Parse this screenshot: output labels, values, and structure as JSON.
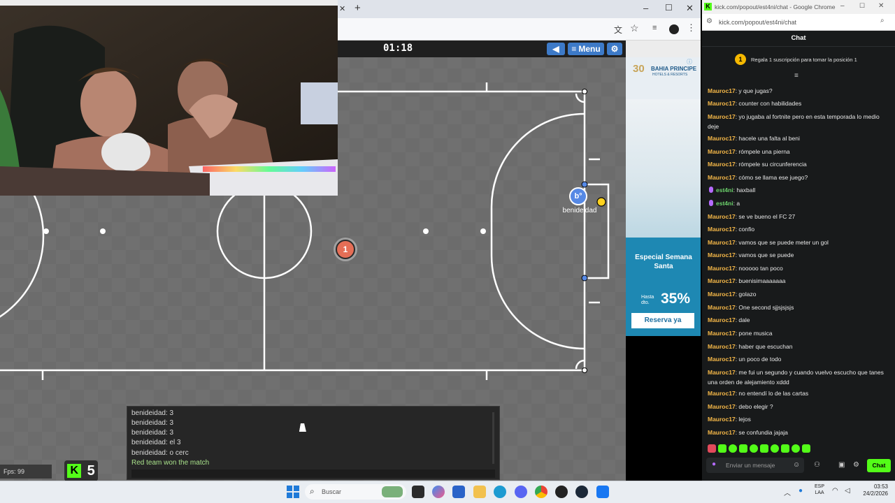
{
  "browser_left": {
    "new_tab_label": "+",
    "window_controls": [
      "–",
      "☐",
      "✕"
    ]
  },
  "game": {
    "timer": "01:18",
    "menu_label": "Menu",
    "player_red_number": "1",
    "player_blue_label": "b°",
    "player_blue_name": "benideidad",
    "fps": "Fps: 99",
    "kick_score": "5",
    "chat": [
      "benideidad: 3",
      "benideidad: 3",
      "benideidad: 3",
      "benideidad: el 3",
      "benideidad: o cerc",
      "Red team won the match"
    ]
  },
  "ad": {
    "brand": "BAHIA PRINCIPE",
    "brand_sub": "HOTELS & RESORTS",
    "logo_number": "30",
    "headline": "Especial Semana Santa",
    "discount_prefix": "Hasta dto.",
    "discount": "35%",
    "cta": "Reserva ya"
  },
  "kick": {
    "window_title": "kick.com/popout/est4ni/chat - Google Chrome",
    "url": "kick.com/popout/est4ni/chat",
    "header": "Chat",
    "pinned": "Regala 1 suscripción para tomar la posición 1",
    "pinned_rank": "1",
    "messages": [
      {
        "user": "Mauroc17",
        "text": "y que jugas?"
      },
      {
        "user": "Mauroc17",
        "text": "counter con habilidades"
      },
      {
        "user": "Mauroc17",
        "text": "yo jugaba al fortnite pero en esta temporada lo medio deje"
      },
      {
        "user": "Mauroc17",
        "text": "hacele una falta al beni"
      },
      {
        "user": "Mauroc17",
        "text": "rómpele una pierna"
      },
      {
        "user": "Mauroc17",
        "text": "rómpele su circunferencia"
      },
      {
        "user": "Mauroc17",
        "text": "cómo se llama ese juego?"
      },
      {
        "user": "est4ni",
        "text": "haxball"
      },
      {
        "user": "est4ni",
        "text": "a"
      },
      {
        "user": "Mauroc17",
        "text": "se ve bueno el FC 27"
      },
      {
        "user": "Mauroc17",
        "text": "confio"
      },
      {
        "user": "Mauroc17",
        "text": "vamos que se puede meter un gol"
      },
      {
        "user": "Mauroc17",
        "text": "vamos que se puede"
      },
      {
        "user": "Mauroc17",
        "text": "nooooo tan poco"
      },
      {
        "user": "Mauroc17",
        "text": "buenisimaaaaaaa"
      },
      {
        "user": "Mauroc17",
        "text": "golazo"
      },
      {
        "user": "Mauroc17",
        "text": "One second sjjsjsjsjs"
      },
      {
        "user": "Mauroc17",
        "text": "dale"
      },
      {
        "user": "Mauroc17",
        "text": "pone musica"
      },
      {
        "user": "Mauroc17",
        "text": "haber que escuchan"
      },
      {
        "user": "Mauroc17",
        "text": "un poco de todo"
      },
      {
        "user": "Mauroc17",
        "text": "me fui un segundo y cuando vuelvo escucho que tanes una orden de alejamiento xddd"
      },
      {
        "user": "Mauroc17",
        "text": "no entendí lo de las cartas"
      },
      {
        "user": "Mauroc17",
        "text": "debo elegir ?"
      },
      {
        "user": "Mauroc17",
        "text": "lejos"
      },
      {
        "user": "Mauroc17",
        "text": "se confundia jajaja"
      }
    ],
    "input_placeholder": "Enviar un mensaje",
    "send_label": "Chat"
  },
  "taskbar": {
    "search_placeholder": "Buscar",
    "lang_top": "ESP",
    "lang_bottom": "LAA",
    "time": "03:53",
    "date": "24/2/2026"
  },
  "colors": {
    "kick_green": "#53fc18",
    "red_team": "#e56e56",
    "blue_team": "#5689e5",
    "username": "#f6b848"
  }
}
